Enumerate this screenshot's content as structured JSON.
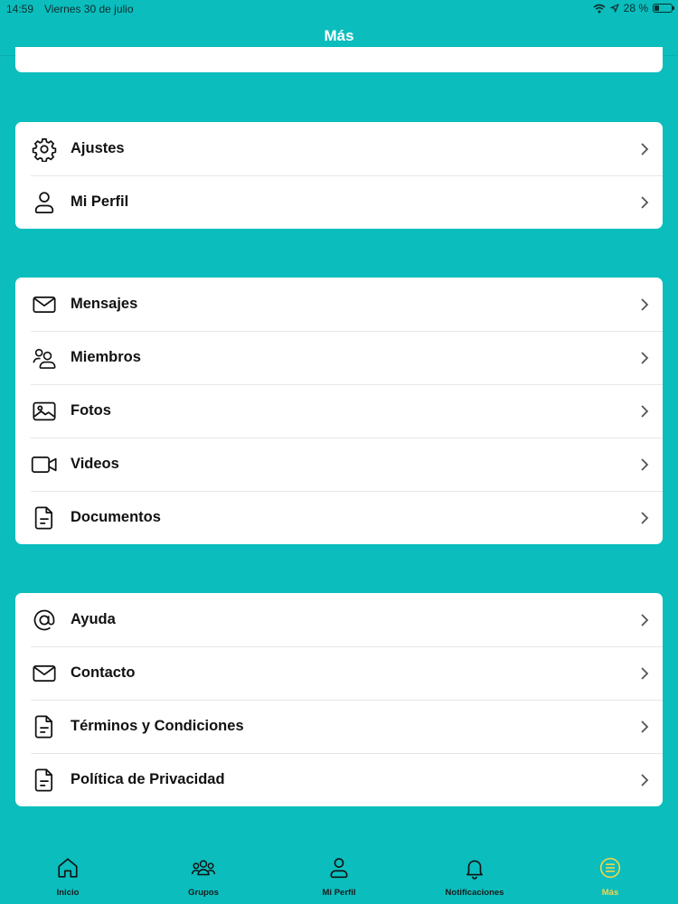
{
  "status_bar": {
    "time": "14:59",
    "date": "Viernes 30 de julio",
    "battery_text": "28 %",
    "battery_level_percent": 28
  },
  "header": {
    "title": "Más"
  },
  "sections": [
    {
      "items": [
        {
          "label": "Ajustes",
          "icon": "gear-icon"
        },
        {
          "label": "Mi Perfil",
          "icon": "user-icon"
        }
      ]
    },
    {
      "items": [
        {
          "label": "Mensajes",
          "icon": "envelope-icon"
        },
        {
          "label": "Miembros",
          "icon": "members-icon"
        },
        {
          "label": "Fotos",
          "icon": "photo-icon"
        },
        {
          "label": "Videos",
          "icon": "video-camera-icon"
        },
        {
          "label": "Documentos",
          "icon": "document-icon"
        }
      ]
    },
    {
      "items": [
        {
          "label": "Ayuda",
          "icon": "at-sign-icon"
        },
        {
          "label": "Contacto",
          "icon": "envelope-icon"
        },
        {
          "label": "Términos y Condiciones",
          "icon": "document-icon"
        },
        {
          "label": "Política de Privacidad",
          "icon": "document-icon"
        }
      ]
    }
  ],
  "tabbar": {
    "tabs": [
      {
        "label": "Inicio",
        "icon": "home-icon"
      },
      {
        "label": "Grupos",
        "icon": "group-icon"
      },
      {
        "label": "Mi Perfil",
        "icon": "user-icon"
      },
      {
        "label": "Notificaciones",
        "icon": "bell-icon"
      },
      {
        "label": "Más",
        "icon": "menu-circle-icon",
        "active": true
      }
    ]
  },
  "colors": {
    "background": "#0BBDBD",
    "card": "#FFFFFF",
    "active_tab": "#F2D64B"
  }
}
